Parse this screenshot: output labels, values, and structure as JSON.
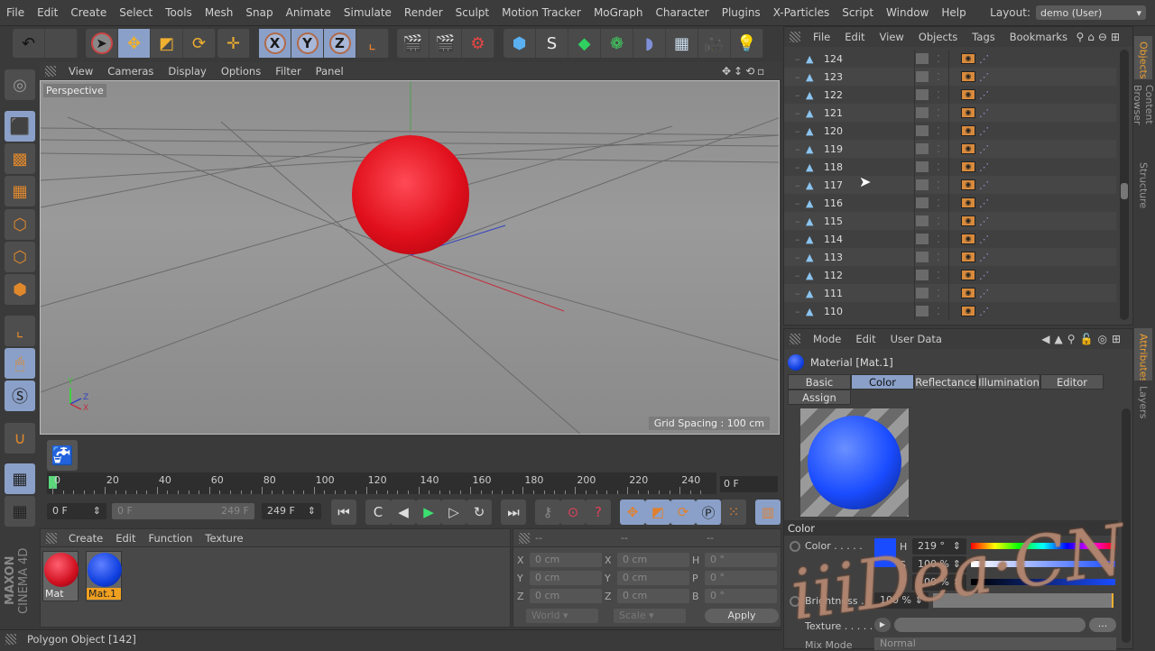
{
  "menubar": {
    "items": [
      "File",
      "Edit",
      "Create",
      "Select",
      "Tools",
      "Mesh",
      "Snap",
      "Animate",
      "Simulate",
      "Render",
      "Sculpt",
      "Motion Tracker",
      "MoGraph",
      "Character",
      "Plugins",
      "X-Particles",
      "Script",
      "Window",
      "Help"
    ],
    "layout_label": "Layout:",
    "layout_value": "demo (User)"
  },
  "toolbar": {
    "buttons": [
      "undo",
      "redo",
      "live-selection",
      "move",
      "scale",
      "rotate",
      "recent-tool",
      "x-axis",
      "y-axis",
      "z-axis",
      "coordinate-system",
      "render-view",
      "render-picture-viewer",
      "render-settings",
      "cube",
      "pen-spline",
      "subdivision-surface",
      "cloner",
      "deformer-bend",
      "floor",
      "camera",
      "light"
    ],
    "axis_labels": [
      "X",
      "Y",
      "Z"
    ]
  },
  "left_toolbar": [
    "make-editable",
    "model-mode",
    "texture-mode",
    "workplane-mode",
    "points-mode",
    "edges-mode",
    "polygons-mode",
    "axis-mode",
    "tweak-mode",
    "snap",
    "magnet",
    "locked-workplane",
    "planar-workplane"
  ],
  "viewport": {
    "menu": [
      "View",
      "Cameras",
      "Display",
      "Options",
      "Filter",
      "Panel"
    ],
    "camera_label": "Perspective",
    "grid_spacing": "Grid Spacing : 100 cm",
    "axis_labels": {
      "y": "Y",
      "z": "Z",
      "x": "X"
    }
  },
  "timeline": {
    "ticks": [
      "0",
      "20",
      "40",
      "60",
      "80",
      "100",
      "120",
      "140",
      "160",
      "180",
      "200",
      "220",
      "240"
    ],
    "current_frame": "0 F",
    "start_frame": "0 F",
    "range_start": "0 F",
    "range_end": "249 F",
    "end_frame": "249 F"
  },
  "material_manager": {
    "menu": [
      "Create",
      "Edit",
      "Function",
      "Texture"
    ],
    "materials": [
      {
        "name": "Mat",
        "color": "#e01020",
        "selected": false
      },
      {
        "name": "Mat.1",
        "color": "#1040e0",
        "selected": true
      }
    ]
  },
  "coordinates": {
    "headers": [
      "--",
      "--",
      "--"
    ],
    "rows": [
      {
        "l1": "X",
        "v1": "0 cm",
        "l2": "X",
        "v2": "0 cm",
        "l3": "H",
        "v3": "0 °"
      },
      {
        "l1": "Y",
        "v1": "0 cm",
        "l2": "Y",
        "v2": "0 cm",
        "l3": "P",
        "v3": "0 °"
      },
      {
        "l1": "Z",
        "v1": "0 cm",
        "l2": "Z",
        "v2": "0 cm",
        "l3": "B",
        "v3": "0 °"
      }
    ],
    "space": "World",
    "mode": "Scale",
    "apply_label": "Apply"
  },
  "status_bar": {
    "text": "Polygon Object [142]"
  },
  "brand": {
    "maxon": "MAXON",
    "product": "CINEMA 4D"
  },
  "object_manager": {
    "menu": [
      "File",
      "Edit",
      "View",
      "Objects",
      "Tags",
      "Bookmarks"
    ],
    "objects": [
      "124",
      "123",
      "122",
      "121",
      "120",
      "119",
      "118",
      "117",
      "116",
      "115",
      "114",
      "113",
      "112",
      "111",
      "110"
    ]
  },
  "side_tabs_top": [
    "Objects",
    "Content Browser",
    "Structure"
  ],
  "side_tabs_bottom": [
    "Attributes",
    "Layers"
  ],
  "attribute_manager": {
    "menu": [
      "Mode",
      "Edit",
      "User Data"
    ],
    "title": "Material [Mat.1]",
    "tabs": [
      "Basic",
      "Color",
      "Reflectance",
      "Illumination",
      "Editor",
      "Assign"
    ],
    "active_tab": "Color",
    "section": "Color",
    "color_label": "Color . . . . .",
    "swatch": "#1a4cff",
    "h_label": "H",
    "h_value": "219 °",
    "s_label": "S",
    "s_value": "100 %",
    "v_label": "V",
    "v_value": "100 %",
    "brightness_label": "Brightness . . .",
    "brightness_value": "100 %",
    "texture_label": "Texture . . . . . . .",
    "texture_button": "...",
    "mix_mode_label": "Mix Mode",
    "mix_mode_value": "Normal"
  },
  "watermark": "iiiDea·CN"
}
